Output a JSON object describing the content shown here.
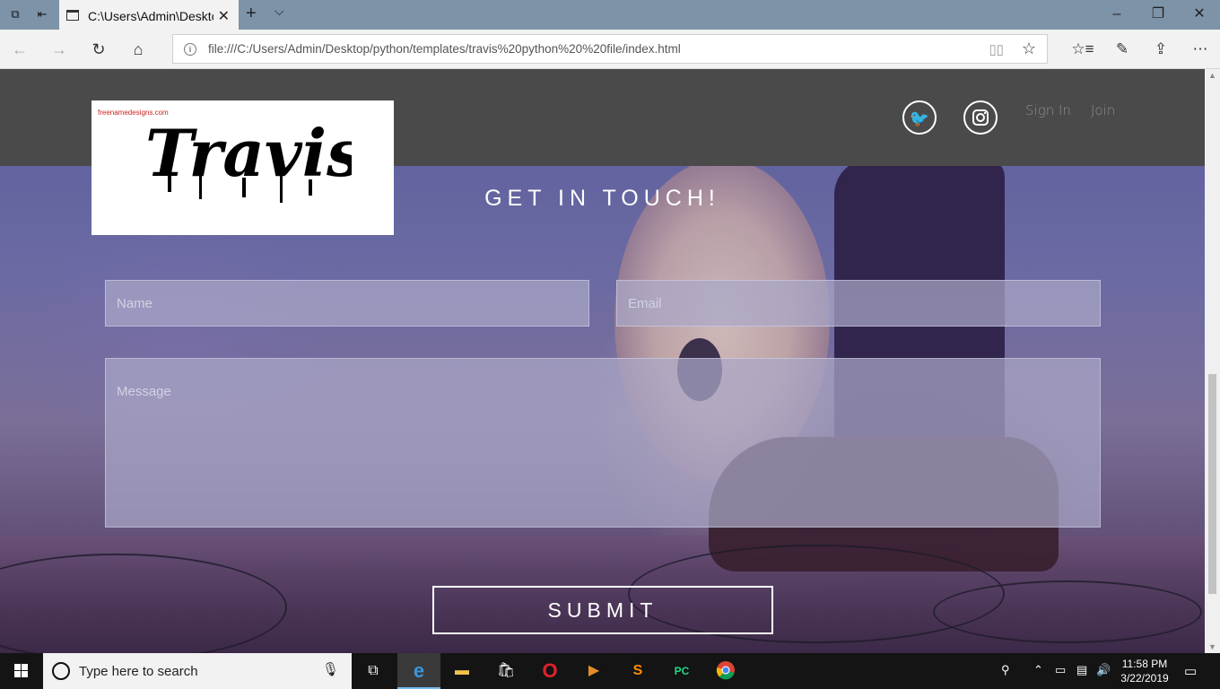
{
  "browser": {
    "tab_title": "C:\\Users\\Admin\\Deskto",
    "address": "file:///C:/Users/Admin/Desktop/python/templates/travis%20python%20%20file/index.html"
  },
  "site": {
    "logo_small_text": "freenamedesigns.com",
    "logo_text": "Travis",
    "nav": {
      "sign_in": "Sign In",
      "join": "Join"
    },
    "section_title": "GET IN TOUCH!",
    "form": {
      "name_placeholder": "Name",
      "email_placeholder": "Email",
      "message_placeholder": "Message",
      "submit_label": "SUBMIT"
    }
  },
  "taskbar": {
    "search_placeholder": "Type here to search",
    "time": "11:58 PM",
    "date": "3/22/2019"
  },
  "colors": {
    "header_bg": "#4a4a4a",
    "taskbar_bg": "#141414",
    "accent": "#0078d7"
  }
}
